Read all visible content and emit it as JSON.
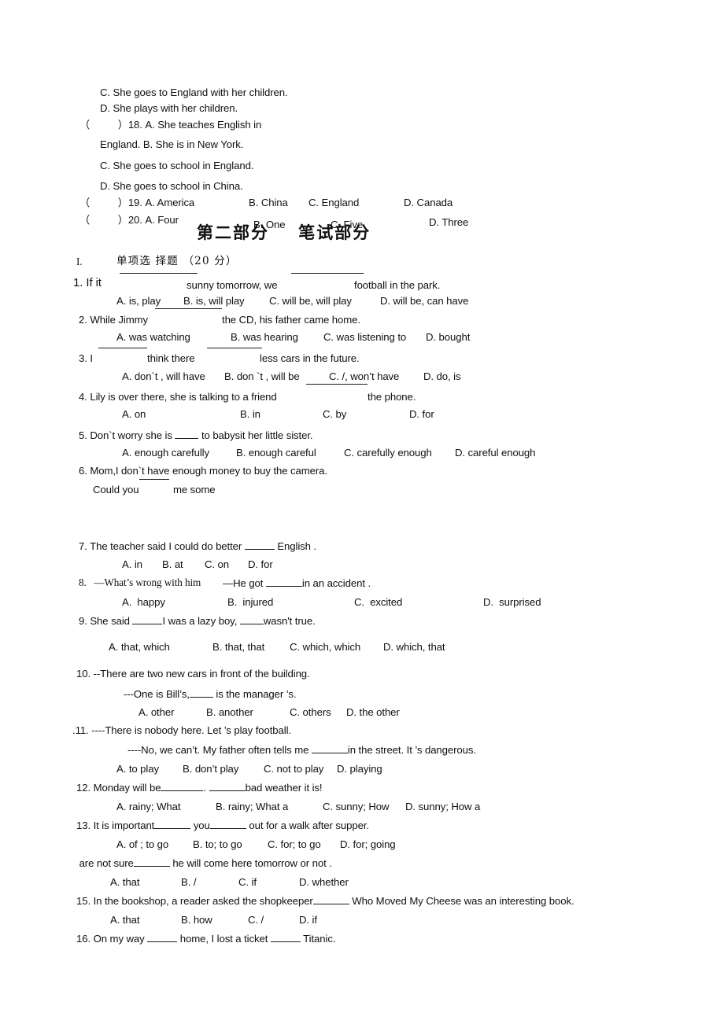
{
  "document": {
    "type": "scanned-exam-paper",
    "page_background": "#ffffff",
    "text_color": "#101010"
  },
  "listening_tail": {
    "opt_c_17": "C. She goes to England with her children.",
    "opt_d_17": "D. She plays with her children.",
    "q18_marker": "（          ）18. A. She teaches English in",
    "q18_cont": "England. B. She is in New York.",
    "q18_opt_c": "C. She goes to school in England.",
    "q18_opt_d": "D. She goes to school in China.",
    "q19_marker": "（          ）19. A. America",
    "q19_b": "B. China",
    "q19_c": "C. England",
    "q19_d": "D. Canada",
    "q20_marker": "（          ）20. A. Four",
    "q20_b": "B. One",
    "q20_c": "C. Five",
    "q20_d": "D. Three"
  },
  "part_heading": {
    "title": "第二部分    笔试部分"
  },
  "section": {
    "numeral": "I.",
    "label": "单项选 择题 （20 分）"
  },
  "questions": [
    {
      "id": "q1",
      "stem_a": "1. If it",
      "stem_b": "sunny tomorrow, we",
      "stem_c": "football in the park.",
      "options": [
        "A. is, play",
        "B. is, will play",
        "C. will be, will play",
        "D. will be, can have"
      ]
    },
    {
      "id": "q2",
      "stem_a": "2. While Jimmy",
      "stem_b": "the CD, his father came home.",
      "options": [
        "A. was watching",
        "B. was hearing",
        "C. was listening to",
        "D. bought"
      ]
    },
    {
      "id": "q3",
      "stem_a": "3. I",
      "stem_b": "think there",
      "stem_c": "less cars in the future.",
      "options": [
        "A. don`t , will have",
        "B. don `t , will be",
        "C. /, won’t have",
        "D. do, is"
      ]
    },
    {
      "id": "q4",
      "stem_a": "4. Lily is over there, she is talking to a friend",
      "stem_b": "the phone.",
      "options": [
        "A. on",
        "B. in",
        "C. by",
        "D. for"
      ]
    },
    {
      "id": "q5",
      "stem_pre": "5. Don`t worry she is ",
      "stem_post": " to babysit her little sister.",
      "options": [
        "A. enough carefully",
        "B. enough careful",
        "C. carefully enough",
        "D. careful enough"
      ]
    },
    {
      "id": "q6",
      "stem_a": "6. Mom,I don`t have enough money to buy the camera.",
      "stem_b": "Could you",
      "stem_c": "me some"
    },
    {
      "id": "q7",
      "stem_pre": "7. The teacher said I could do better ",
      "stem_post": " English .",
      "options": [
        "A. in",
        "B. at",
        "C. on",
        "D. for"
      ]
    },
    {
      "id": "q8",
      "stem_serif": "8.   —What’s wrong with him",
      "stem_sans_pre": "—He got ",
      "stem_sans_post": "in an accident .",
      "options": [
        "A.  happy",
        "B.  injured",
        "C.  excited",
        "D.  surprised"
      ]
    },
    {
      "id": "q9",
      "stem_pre": "9. She said ",
      "stem_mid": "I was a lazy boy, ",
      "stem_post": "wasn't true.",
      "options": [
        "A. that, which",
        "B. that, that",
        "C. which, which",
        "D. which, that"
      ]
    },
    {
      "id": "q10",
      "stem_a": "10. --There are two new cars in front of the building.",
      "stem_b_pre": "---One is Bill’s,",
      "stem_b_post": " is the manager ’s.",
      "options": [
        "A. other",
        "B. another",
        "C. others",
        "D. the other"
      ]
    },
    {
      "id": "q11",
      "stem_a": ".11. ----There is nobody here. Let ’s play football.",
      "stem_b_pre": "----No, we can’t. My father often tells me ",
      "stem_b_post": "in the street. It ’s dangerous.",
      "options": [
        "A. to play",
        "B. don’t play",
        "C. not to play",
        "D. playing"
      ]
    },
    {
      "id": "q12",
      "stem_pre": "12. Monday will be",
      "stem_mid": ". ",
      "stem_post": "bad weather it is!",
      "options": [
        "A. rainy; What",
        "B. rainy; What a",
        "C. sunny; How",
        "D. sunny; How a"
      ]
    },
    {
      "id": "q13",
      "stem_pre": "13. It is important",
      "stem_mid": " you",
      "stem_post": " out for a walk after supper.",
      "options": [
        "A. of ; to go",
        "B. to; to go",
        "C. for; to go",
        "D. for; going"
      ]
    },
    {
      "id": "q14",
      "stem_pre": " are not sure",
      "stem_post": " he will come here tomorrow or not .",
      "options": [
        "A. that",
        "B. /",
        "C. if",
        "D. whether"
      ]
    },
    {
      "id": "q15",
      "stem_pre": "15. In the bookshop, a reader asked the shopkeeper",
      "stem_post": " Who Moved My Cheese was an interesting book.",
      "options": [
        "A. that",
        "B. how",
        "C. /",
        "D. if"
      ]
    },
    {
      "id": "q16",
      "stem_pre": "16. On my way ",
      "stem_mid": " home, I lost a ticket ",
      "stem_post": " Titanic."
    }
  ]
}
